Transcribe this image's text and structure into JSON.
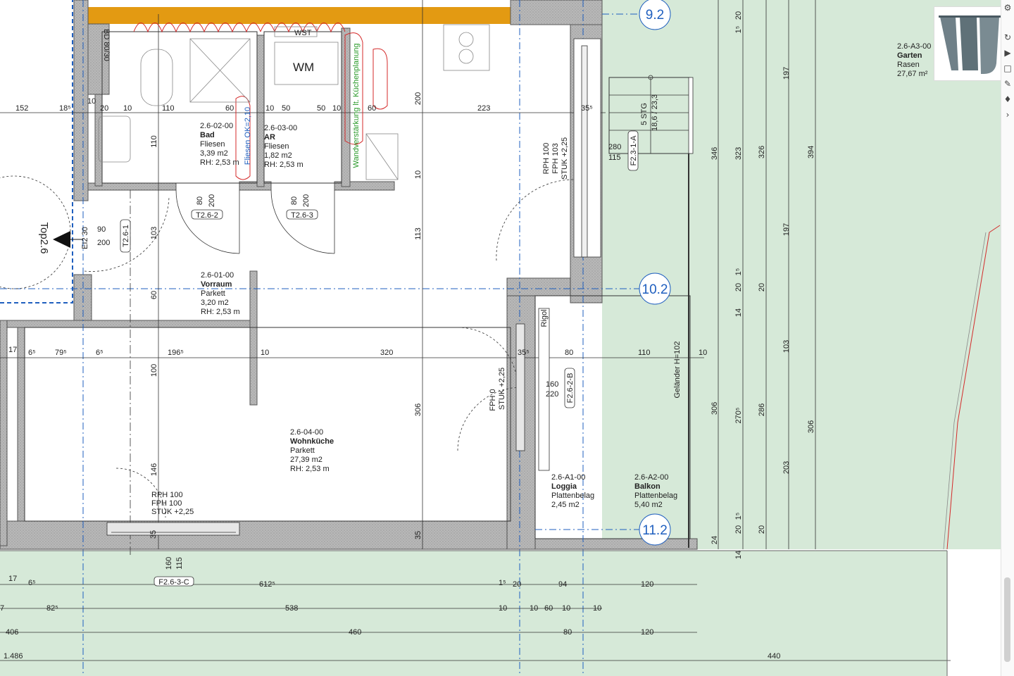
{
  "rooms": {
    "bad": {
      "code": "2.6-02-00",
      "name": "Bad",
      "floor": "Fliesen",
      "area": "3,39 m2",
      "height": "RH: 2,53 m"
    },
    "ar": {
      "code": "2.6-03-00",
      "name": "AR",
      "floor": "Fliesen",
      "area": "1,82 m2",
      "height": "RH: 2,53 m"
    },
    "vorraum": {
      "code": "2.6-01-00",
      "name": "Vorraum",
      "floor": "Parkett",
      "area": "3,20 m2",
      "height": "RH: 2,53 m"
    },
    "wohnkueche": {
      "code": "2.6-04-00",
      "name": "Wohnküche",
      "floor": "Parkett",
      "area": "27,39 m2",
      "height": "RH: 2,53 m"
    },
    "loggia": {
      "code": "2.6-A1-00",
      "name": "Loggia",
      "floor": "Plattenbelag",
      "area": "2,45 m2"
    },
    "balkon": {
      "code": "2.6-A2-00",
      "name": "Balkon",
      "floor": "Plattenbelag",
      "area": "5,40 m2"
    },
    "garten": {
      "code": "2.6-A3-00",
      "name": "Garten",
      "floor": "Rasen",
      "area": "27,67 m²"
    }
  },
  "axes": [
    "9.2",
    "10.2",
    "11.2"
  ],
  "tags": {
    "wm": "WM",
    "wst": "WST",
    "top": "Top2.6",
    "t262": "T2.6-2",
    "t263": "T2.6-3",
    "t261": "T2.6-1",
    "f23c": "F2.6-3-C",
    "f62b": "F2.6-2-B",
    "f23a": "F2.3-1-A",
    "rigol": "Rigol",
    "gelaender": "Geländer H=102",
    "fliesen_ok": "Fliesen OK=2,10",
    "wand": "Wandverstärkung lt. Küchenplanung",
    "ei30": "EI2 30",
    "bd": "BD 80/30",
    "stg": "5 STG",
    "stg2": "18,6 / 23,3"
  },
  "notes": {
    "w1": [
      "RPH 100",
      "FPH 103",
      "STUK +2,25"
    ],
    "w2": [
      "RPH 100",
      "FPH 100",
      "STUK +2,25"
    ],
    "w3": [
      "FPH 0",
      "STUK +2,25"
    ]
  },
  "dims": {
    "r1": [
      "152",
      "18⁵",
      "10",
      "20",
      "10",
      "110",
      "60",
      "10",
      "50",
      "50",
      "10",
      "60",
      "223",
      "35⁵"
    ],
    "r2": [
      "17",
      "6⁵",
      "79⁵",
      "6⁵",
      "196⁵",
      "10",
      "320",
      "35⁵",
      "80",
      "110",
      "10"
    ],
    "b1": [
      "17",
      "6⁵",
      "612⁵",
      "1⁵",
      "20",
      "94",
      "120"
    ],
    "b2": [
      "7",
      "82⁵",
      "538",
      "10",
      "10",
      "60",
      "10",
      "10"
    ],
    "b3": [
      "406",
      "460",
      "80",
      "120"
    ],
    "b4": [
      "1.486",
      "440"
    ],
    "v1": [
      "200",
      "10",
      "113",
      "306"
    ],
    "v2": [
      "110",
      "103",
      "60",
      "100",
      "146"
    ],
    "v3": [
      "80",
      "200",
      "80",
      "200",
      "90",
      "200",
      "160",
      "115",
      "160",
      "220",
      "280",
      "115"
    ],
    "v4": [
      "1⁵",
      "20",
      "197",
      "346",
      "323",
      "326",
      "394",
      "197",
      "1⁵",
      "20",
      "20",
      "14",
      "103",
      "306",
      "270⁵",
      "286",
      "306",
      "203",
      "1⁵",
      "20",
      "20",
      "24",
      "14",
      "35",
      "35"
    ]
  },
  "colors": {
    "wall": "#b4b4b4",
    "garden": "#d6e9d8",
    "axis": "#1f5fbf",
    "orange": "#e39a12",
    "red": "#d42a2a",
    "green": "#2a9a2a"
  },
  "icons": [
    "logo-icon",
    "gear-icon",
    "pen-icon",
    "book-icon",
    "edit-icon",
    "chevron-icon"
  ]
}
